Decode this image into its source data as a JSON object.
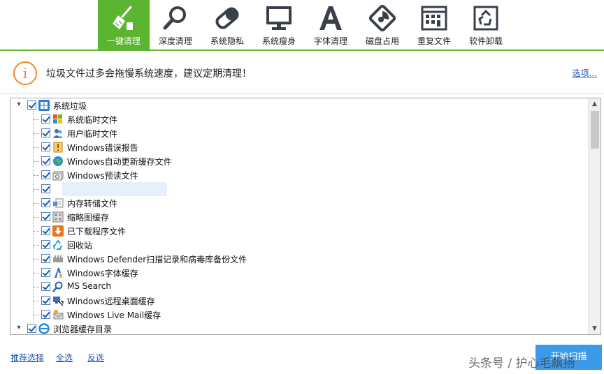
{
  "toolbar": {
    "active_color": "#5cb531",
    "tools": [
      {
        "label": "一键清理",
        "icon": "broom-icon",
        "active": true
      },
      {
        "label": "深度清理",
        "icon": "magnifier-icon"
      },
      {
        "label": "系统隐私",
        "icon": "eraser-icon"
      },
      {
        "label": "系统瘦身",
        "icon": "monitor-icon"
      },
      {
        "label": "字体清理",
        "icon": "font-letter-icon"
      },
      {
        "label": "磁盘占用",
        "icon": "disk-pie-icon"
      },
      {
        "label": "重复文件",
        "icon": "duplicate-files-icon"
      },
      {
        "label": "软件卸载",
        "icon": "recycle-bin-icon"
      }
    ]
  },
  "info": {
    "icon": "info-icon",
    "message": "垃圾文件过多会拖慢系统速度，建议定期清理！",
    "options_link": "选项..."
  },
  "tree": {
    "root1": {
      "label": "系统垃圾",
      "icon": "windows-logo-icon",
      "checked": true
    },
    "children": [
      {
        "label": "系统临时文件",
        "icon": "windows-flag-icon",
        "checked": true
      },
      {
        "label": "用户临时文件",
        "icon": "users-icon",
        "checked": true
      },
      {
        "label": "Windows错误报告",
        "icon": "error-report-icon",
        "checked": true
      },
      {
        "label": "Windows自动更新缓存文件",
        "icon": "update-globe-icon",
        "checked": true
      },
      {
        "label": "Windows预读文件",
        "icon": "prefetch-icon",
        "checked": true
      },
      {
        "label": "",
        "icon": "",
        "checked": true
      },
      {
        "label": "内存转储文件",
        "icon": "memory-dump-icon",
        "checked": true
      },
      {
        "label": "缩略图缓存",
        "icon": "thumbnail-icon",
        "checked": true
      },
      {
        "label": "已下载程序文件",
        "icon": "download-icon",
        "checked": true
      },
      {
        "label": "回收站",
        "icon": "recycle-icon",
        "checked": true
      },
      {
        "label": "Windows Defender扫描记录和病毒库备份文件",
        "icon": "defender-icon",
        "checked": true
      },
      {
        "label": "Windows字体缓存",
        "icon": "font-cache-icon",
        "checked": true
      },
      {
        "label": "MS Search",
        "icon": "search-icon",
        "checked": true
      },
      {
        "label": "Windows远程桌面缓存",
        "icon": "remote-desktop-icon",
        "checked": true
      },
      {
        "label": "Windows Live Mail缓存",
        "icon": "live-mail-icon",
        "checked": true
      }
    ],
    "root2": {
      "label": "浏览器缓存目录",
      "icon": "ie-browser-icon",
      "checked": true
    }
  },
  "footer": {
    "recommend": "推荐选择",
    "select_all": "全选",
    "invert": "反选",
    "start_button": "开始扫描"
  },
  "watermark": "头条号 / 护心毛飘扬"
}
